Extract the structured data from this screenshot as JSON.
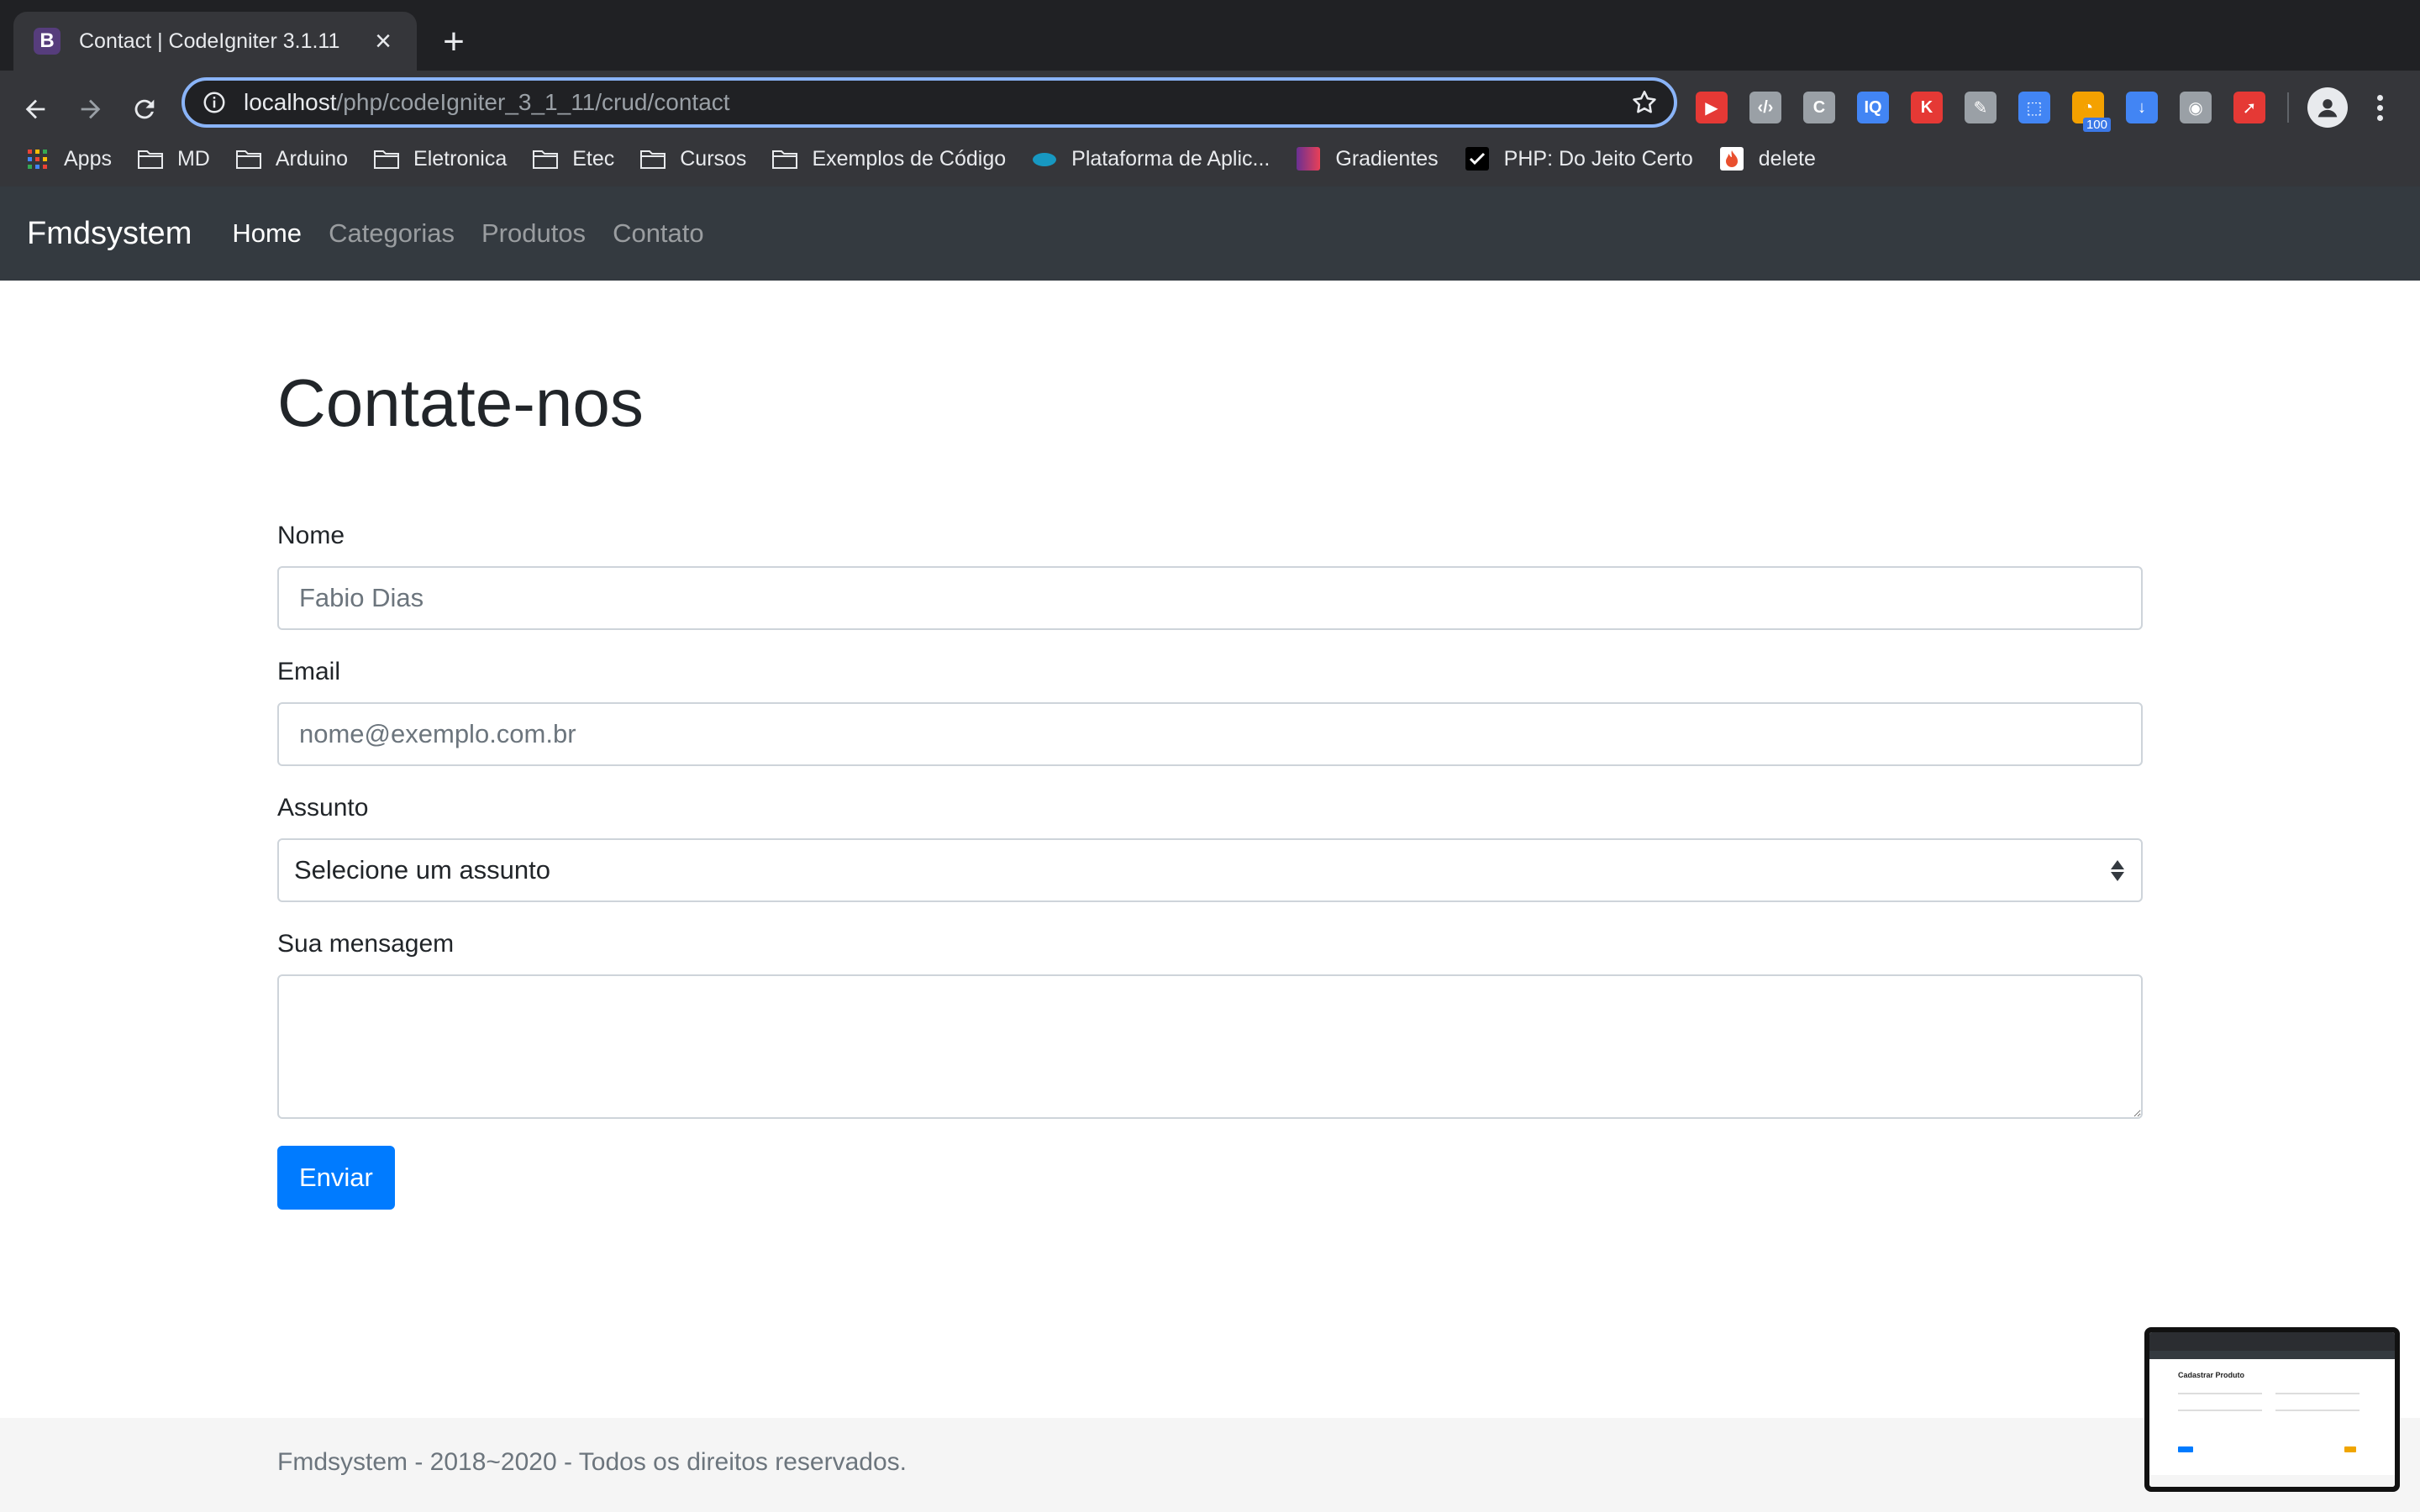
{
  "browser": {
    "tab_title": "Contact | CodeIgniter 3.1.11",
    "tab_favicon_letter": "B",
    "url_host": "localhost",
    "url_path": "/php/codeIgniter_3_1_11/crud/contact",
    "extensions": [
      {
        "name": "youtube-extension-icon",
        "label": "▶",
        "color": "#e53935"
      },
      {
        "name": "code-extension-icon",
        "label": "‹/›",
        "color": "#9aa0a6"
      },
      {
        "name": "grammarly-extension-icon",
        "label": "C",
        "color": "#9aa0a6"
      },
      {
        "name": "iq-extension-icon",
        "label": "IQ",
        "color": "#4285f4"
      },
      {
        "name": "k-extension-icon",
        "label": "K",
        "color": "#e53935"
      },
      {
        "name": "eyedropper-extension-icon",
        "label": "✎",
        "color": "#9aa0a6"
      },
      {
        "name": "window-resizer-extension-icon",
        "label": "⬚",
        "color": "#4285f4"
      },
      {
        "name": "rss-extension-icon",
        "label": "◔",
        "color": "#f4a100",
        "badge": "100"
      },
      {
        "name": "download-extension-icon",
        "label": "↓",
        "color": "#4285f4"
      },
      {
        "name": "circle-extension-icon",
        "label": "◉",
        "color": "#9aa0a6"
      },
      {
        "name": "rocket-extension-icon",
        "label": "➚",
        "color": "#e53935"
      }
    ],
    "bookmarks": [
      {
        "name": "bookmark-apps",
        "label": "Apps",
        "icon": "apps-grid-icon"
      },
      {
        "name": "bookmark-md",
        "label": "MD",
        "icon": "folder-icon"
      },
      {
        "name": "bookmark-arduino",
        "label": "Arduino",
        "icon": "folder-icon"
      },
      {
        "name": "bookmark-eletronica",
        "label": "Eletronica",
        "icon": "folder-icon"
      },
      {
        "name": "bookmark-etec",
        "label": "Etec",
        "icon": "folder-icon"
      },
      {
        "name": "bookmark-cursos",
        "label": "Cursos",
        "icon": "folder-icon"
      },
      {
        "name": "bookmark-exemplos",
        "label": "Exemplos de Código",
        "icon": "folder-icon"
      },
      {
        "name": "bookmark-plataforma",
        "label": "Plataforma de Aplic...",
        "icon": "salesforce-cloud-icon"
      },
      {
        "name": "bookmark-gradientes",
        "label": "Gradientes",
        "icon": "gradient-icon"
      },
      {
        "name": "bookmark-php",
        "label": "PHP: Do Jeito Certo",
        "icon": "checkmark-icon"
      },
      {
        "name": "bookmark-delete",
        "label": "delete",
        "icon": "fire-icon"
      }
    ]
  },
  "navbar": {
    "brand": "Fmdsystem",
    "links": [
      {
        "label": "Home",
        "active": true
      },
      {
        "label": "Categorias",
        "active": false
      },
      {
        "label": "Produtos",
        "active": false
      },
      {
        "label": "Contato",
        "active": false
      }
    ]
  },
  "page": {
    "title": "Contate-nos",
    "form": {
      "name_label": "Nome",
      "name_placeholder": "Fabio Dias",
      "email_label": "Email",
      "email_placeholder": "nome@exemplo.com.br",
      "subject_label": "Assunto",
      "subject_selected": "Selecione um assunto",
      "message_label": "Sua mensagem",
      "message_value": "",
      "submit_label": "Enviar"
    }
  },
  "footer": {
    "text": "Fmdsystem - 2018~2020 - Todos os direitos reservados."
  },
  "thumbnail": {
    "title": "Cadastrar Produto"
  },
  "colors": {
    "primary": "#007bff",
    "navbar_bg": "#343a40",
    "omnibox_focus": "#8ab4f8"
  }
}
